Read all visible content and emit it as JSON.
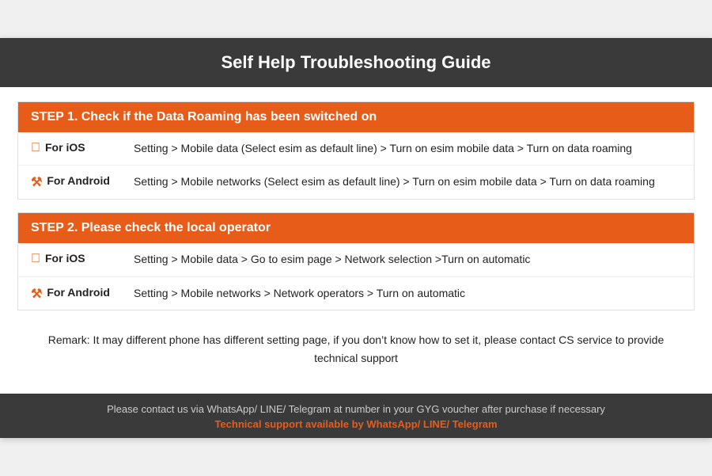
{
  "header": {
    "title": "Self Help Troubleshooting Guide"
  },
  "step1": {
    "heading": "STEP 1.  Check if the Data Roaming has been switched on",
    "ios_label": "For iOS",
    "ios_text": "Setting > Mobile data (Select esim as default line) > Turn on esim mobile data > Turn on data roaming",
    "android_label": "For Android",
    "android_text": "Setting > Mobile networks (Select esim as default line) > Turn on esim mobile data > Turn on data roaming"
  },
  "step2": {
    "heading": "STEP 2.  Please check the local operator",
    "ios_label": "For iOS",
    "ios_text": "Setting > Mobile data > Go to esim page > Network selection >Turn on automatic",
    "android_label": "For Android",
    "android_text": "Setting > Mobile networks > Network operators > Turn on automatic"
  },
  "remark": {
    "text": "Remark: It may different phone has different setting page, if you don’t know how to set it,  please contact CS service to provide technical support"
  },
  "footer": {
    "line1": "Please contact us via WhatsApp/ LINE/ Telegram at number in your GYG voucher after purchase if necessary",
    "line2": "Technical support available by WhatsApp/ LINE/ Telegram"
  }
}
